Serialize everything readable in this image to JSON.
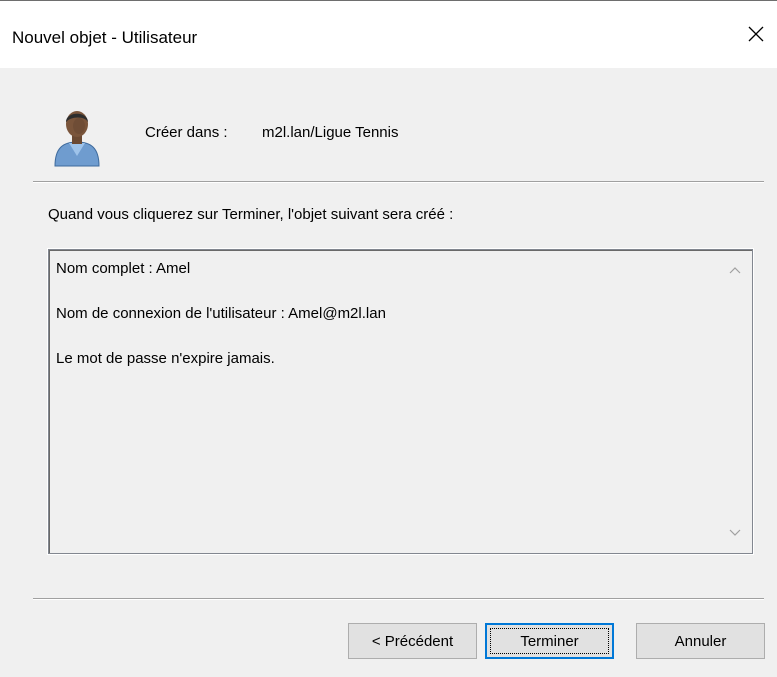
{
  "window": {
    "title": "Nouvel objet - Utilisateur",
    "close_glyph": "✕"
  },
  "header": {
    "icon": "user-icon",
    "create_in_label": "Créer dans :",
    "create_in_path": "m2l.lan/Ligue Tennis"
  },
  "intro_text": "Quand vous cliquerez sur Terminer, l'objet suivant sera créé :",
  "summary": {
    "lines": [
      "Nom complet : Amel",
      "Nom de connexion de l'utilisateur : Amel@m2l.lan",
      "Le mot de passe n'expire jamais."
    ]
  },
  "buttons": {
    "previous": "< Précédent",
    "finish": "Terminer",
    "cancel": "Annuler"
  },
  "colors": {
    "accent": "#0078d7",
    "dialog_bg": "#f0f0f0",
    "titlebar_bg": "#ffffff"
  }
}
